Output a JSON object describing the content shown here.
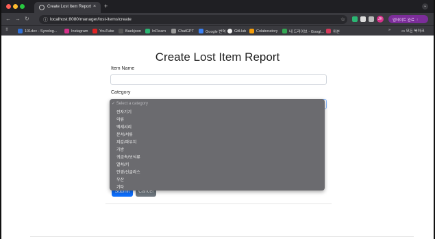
{
  "browser": {
    "tab_title": "Create Lost Item Report",
    "tab_close": "×",
    "new_tab": "+",
    "tab_menu": "⌄",
    "url": "localhost:8080/manager/lost-items/create",
    "update_button": "업데이트 완료 ⋮",
    "avatar_initials": "JH",
    "bookmarks": [
      {
        "label": "101dev - Synolog...",
        "color": "#2f6fd6"
      },
      {
        "label": "Instagram",
        "color": "#d6308a"
      },
      {
        "label": "YouTube",
        "color": "#e02424"
      },
      {
        "label": "Baekjoon",
        "color": "#555555"
      },
      {
        "label": "InFlearn",
        "color": "#2bb673"
      },
      {
        "label": "ChatGPT",
        "color": "#9a9a9a"
      },
      {
        "label": "Google 번역",
        "color": "#3b82f6"
      },
      {
        "label": "GitHub",
        "color": "#f0f0f0"
      },
      {
        "label": "Colaboratory",
        "color": "#f59e0b"
      },
      {
        "label": "내 드라이브 - Googl...",
        "color": "#34a853"
      },
      {
        "label": "위븐",
        "color": "#d63a5a"
      }
    ],
    "bookmarks_overflow": "»",
    "all_bookmarks": "모든 북마크"
  },
  "page": {
    "title": "Create Lost Item Report",
    "item_name_label": "Item Name",
    "category_label": "Category",
    "submit_label": "Submit",
    "cancel_label": "Cancel"
  },
  "dropdown": {
    "placeholder": "✓ Select a category",
    "options": [
      "전자기기",
      "의류",
      "액세서리",
      "문서/서류",
      "지갑/파우치",
      "가방",
      "귀금속/보석류",
      "열쇠/키",
      "안경/선글라스",
      "우산",
      "기타"
    ]
  }
}
